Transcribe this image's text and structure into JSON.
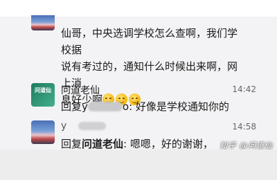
{
  "messages": [
    {
      "text_lines": [
        "仙哥，中央选调学校怎么查啊，我们学校据",
        "说有考过的，通知什么时候出来啊，网上消",
        "息好少啊"
      ],
      "emoji_count": 3,
      "emoji": "smiling-face-icon"
    },
    {
      "sender": "问道老仙",
      "avatar_text": "问道仙",
      "time": "14:42",
      "prefix": "回复y",
      "suffix": "o: 好像是学校通知你的"
    },
    {
      "sender_visible": "y",
      "time": "14:58",
      "prefix": "回复",
      "quoted_name": "问道老仙",
      "suffix": ": 嗯嗯，好的谢谢，"
    }
  ],
  "watermark": "知乎 @问道仙",
  "colors": {
    "chat_bg": "#f3f3f5",
    "text": "#1a1a1a",
    "time": "#666666",
    "redaction": "#c9c9cc"
  }
}
